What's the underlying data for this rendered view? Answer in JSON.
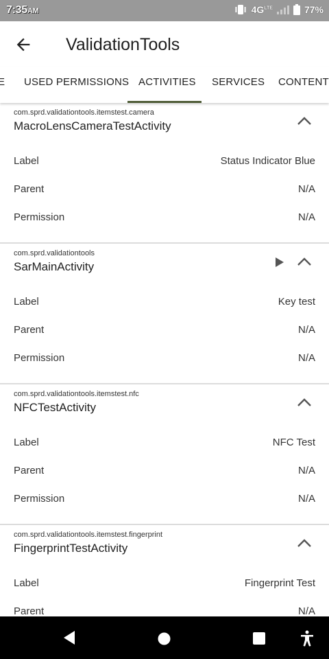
{
  "status_bar": {
    "time": "7:35",
    "ampm": "AM",
    "network": "4G",
    "network_sup": "LTE",
    "battery": "77%"
  },
  "app_bar": {
    "title": "ValidationTools"
  },
  "tabs": [
    {
      "label": "E",
      "selected": false
    },
    {
      "label": "USED PERMISSIONS",
      "selected": false
    },
    {
      "label": "ACTIVITIES",
      "selected": true
    },
    {
      "label": "SERVICES",
      "selected": false
    },
    {
      "label": "CONTENT P",
      "selected": false
    }
  ],
  "activities": [
    {
      "package": "com.sprd.validationtools.itemstest.camera",
      "name": "MacroLensCameraTestActivity",
      "rows": [
        {
          "key": "Label",
          "value": "Status Indicator Blue"
        },
        {
          "key": "Parent",
          "value": "N/A"
        },
        {
          "key": "Permission",
          "value": "N/A"
        }
      ]
    },
    {
      "package": "com.sprd.validationtools",
      "name": "SarMainActivity",
      "rows": [
        {
          "key": "Label",
          "value": "Key test"
        },
        {
          "key": "Parent",
          "value": "N/A"
        },
        {
          "key": "Permission",
          "value": "N/A"
        }
      ]
    },
    {
      "package": "com.sprd.validationtools.itemstest.nfc",
      "name": "NFCTestActivity",
      "rows": [
        {
          "key": "Label",
          "value": "NFC Test"
        },
        {
          "key": "Parent",
          "value": "N/A"
        },
        {
          "key": "Permission",
          "value": "N/A"
        }
      ]
    },
    {
      "package": "com.sprd.validationtools.itemstest.fingerprint",
      "name": "FingerprintTestActivity",
      "rows": [
        {
          "key": "Label",
          "value": "Fingerprint Test"
        },
        {
          "key": "Parent",
          "value": "N/A"
        }
      ]
    }
  ],
  "colors": {
    "tab_indicator": "#4d5b35",
    "status_bar_bg": "#999999",
    "nav_bar_bg": "#000000"
  }
}
